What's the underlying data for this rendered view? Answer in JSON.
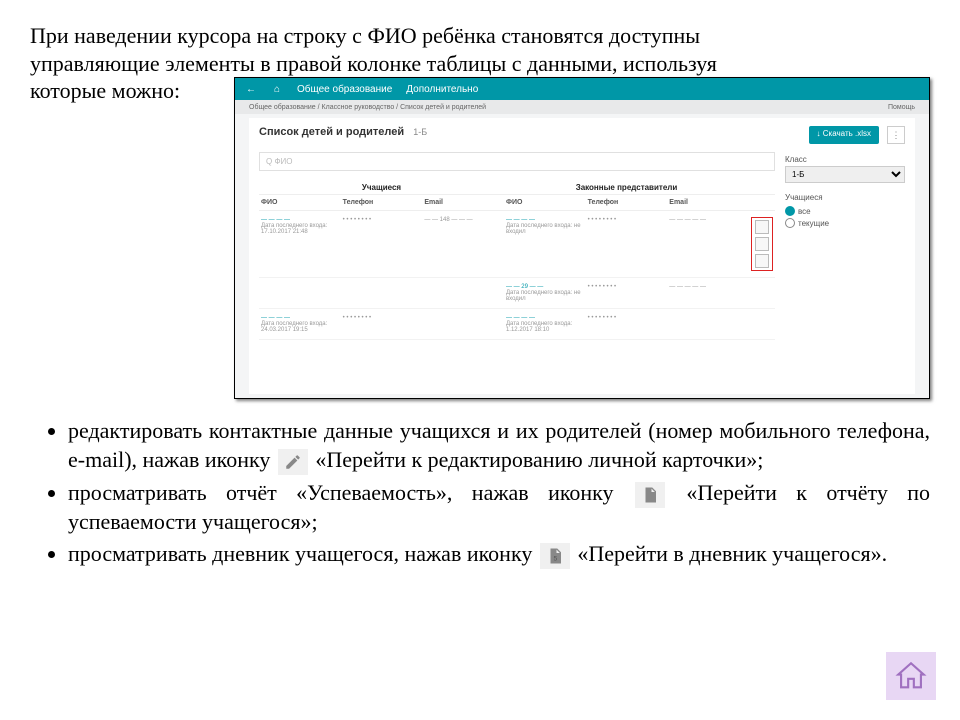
{
  "intro_line1": "При наведении курсора на строку с ФИО ребёнка становятся доступны",
  "intro_line2": "управляющие элементы в правой колонке таблицы с данными, используя",
  "intro_line3": "которые можно:",
  "screenshot": {
    "nav_back": "←",
    "nav_home": "⌂",
    "tab1": "Общее образование",
    "tab2": "Дополнительно",
    "breadcrumb": "Общее образование / Классное руководство / Список детей и родителей",
    "help": "Помощь",
    "title": "Список детей и родителей",
    "subtitle": "1-Б",
    "download": "↓ Скачать .xlsx",
    "search_placeholder": "Q ФИО",
    "group1": "Учащиеся",
    "group2": "Законные представители",
    "headers": [
      "ФИО",
      "Телефон",
      "Email",
      "ФИО",
      "Телефон",
      "Email",
      ""
    ],
    "rows": [
      {
        "c1a": "— — — —",
        "c1b": "Дата последнего входа: 17.10.2017 21:48",
        "c2": "• • • • • • • •",
        "c3": "— — 148 — — —",
        "c4a": "— — — —",
        "c4b": "Дата последнего входа: не входил",
        "c5": "• • • • • • • •",
        "c6": "— — — — —",
        "actions": true
      },
      {
        "c1a": "",
        "c1b": "",
        "c2": "",
        "c3": "",
        "c4a": "— — 29 — —",
        "c4b": "Дата последнего входа: не входил",
        "c5": "• • • • • • • •",
        "c6": "— — — — —",
        "actions": false
      },
      {
        "c1a": "— — — —",
        "c1b": "Дата последнего входа: 24.03.2017 19:15",
        "c2": "• • • • • • • •",
        "c3": "",
        "c4a": "— — — —",
        "c4b": "Дата последнего входа: 1.12.2017 18:10",
        "c5": "• • • • • • • •",
        "c6": "",
        "actions": false
      }
    ],
    "side": {
      "class_label": "Класс",
      "class_value": "1-Б",
      "students_label": "Учащиеся",
      "radio_all": "все",
      "radio_current": "текущие"
    }
  },
  "bullets": {
    "b1a": "редактировать контактные данные учащихся и их родителей (номер мобильного телефона, e-mail), нажав иконку ",
    "b1b": " «Перейти к редактированию личной карточки»;",
    "b2a": "просматривать отчёт «Успеваемость», нажав иконку ",
    "b2b": " «Перейти к отчёту по успеваемости учащегося»;",
    "b3a": "просматривать дневник учащегося, нажав иконку ",
    "b3b": " «Перейти в дневник учащегося»."
  }
}
